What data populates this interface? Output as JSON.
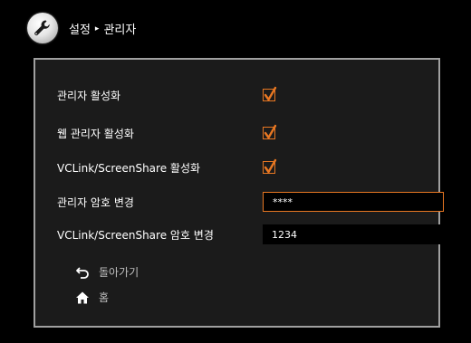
{
  "header": {
    "breadcrumb_parent": "설정",
    "breadcrumb_separator": "▸",
    "breadcrumb_current": "관리자"
  },
  "settings": [
    {
      "label": "관리자 활성화",
      "type": "checkbox",
      "checked": true
    },
    {
      "label": "웹 관리자 활성화",
      "type": "checkbox",
      "checked": true
    },
    {
      "label": "VCLink/ScreenShare 활성화",
      "type": "checkbox",
      "checked": true
    },
    {
      "label": "관리자 암호 변경",
      "type": "password",
      "value": "****",
      "focused": true
    },
    {
      "label": "VCLink/ScreenShare 암호 변경",
      "type": "password",
      "value": "1234",
      "focused": false
    }
  ],
  "nav": {
    "back_label": "돌아가기",
    "back_icon": "back-arrow-icon",
    "home_label": "홈",
    "home_icon": "home-icon"
  },
  "colors": {
    "accent": "#e87722",
    "panel_border": "#a0a0a0",
    "panel_bg": "#1b1b1b"
  }
}
